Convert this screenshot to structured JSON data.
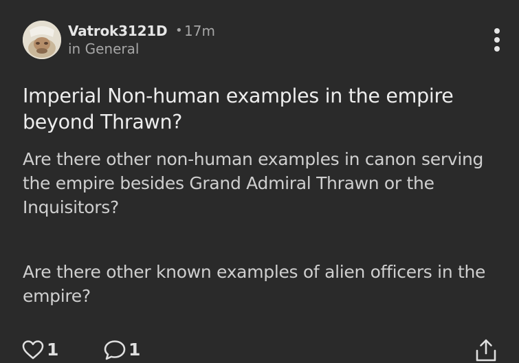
{
  "post": {
    "author": "Vatrok3121D",
    "separator": "•",
    "time": "17m",
    "community": "in General",
    "title": "Imperial Non-human examples in the empire beyond Thrawn?",
    "body": [
      "Are there other non-human examples in canon serving the empire besides Grand Admiral Thrawn or the Inquisitors?",
      "Are there other known examples of alien officers in the empire?"
    ]
  },
  "actions": {
    "likes": "1",
    "comments": "1"
  },
  "icons": {
    "avatar": "user-avatar",
    "more": "more-vertical-icon",
    "like": "heart-icon",
    "comment": "comment-bubble-icon",
    "share": "share-icon"
  },
  "colors": {
    "background": "#2a2a2a",
    "text_primary": "#ededed",
    "text_secondary": "#a6a6a6"
  }
}
